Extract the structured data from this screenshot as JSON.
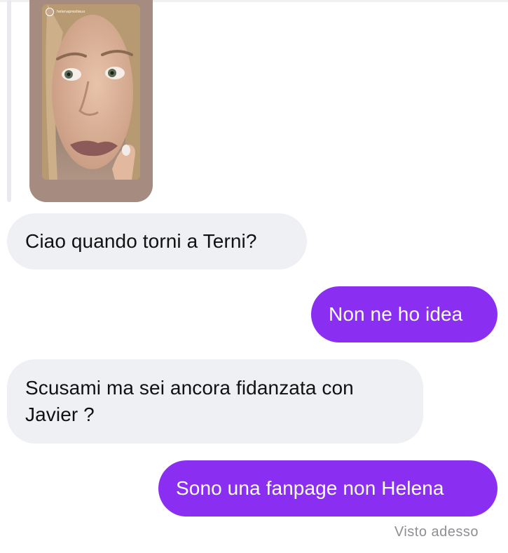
{
  "story": {
    "username": "helenaprestieux"
  },
  "messages": [
    {
      "side": "incoming",
      "text": "Ciao quando torni a Terni?"
    },
    {
      "side": "outgoing",
      "text": "Non ne ho idea"
    },
    {
      "side": "incoming",
      "text": "Scusami ma sei ancora fidanzata con Javier ?"
    },
    {
      "side": "outgoing",
      "text": "Sono una fanpage non Helena"
    }
  ],
  "status": {
    "seen": "Visto adesso"
  },
  "colors": {
    "outgoing_bubble": "#8a2ef2",
    "incoming_bubble": "#eef0f3",
    "story_card": "#a58b80"
  }
}
